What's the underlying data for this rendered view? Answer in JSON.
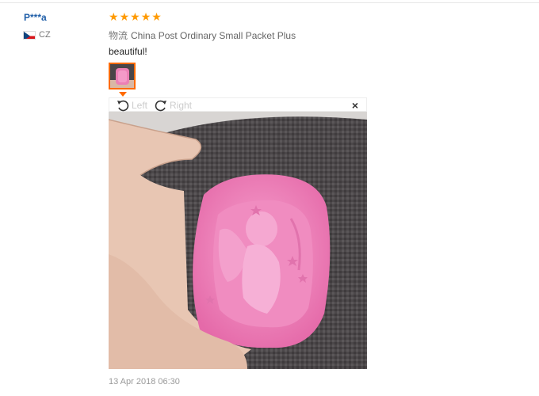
{
  "review": {
    "user_name": "P***a",
    "country_code": "CZ",
    "rating": 5,
    "shipping_label": "物流",
    "shipping_method": "China Post Ordinary Small Packet Plus",
    "feedback": "beautiful!",
    "date": "13 Apr 2018 06:30"
  },
  "viewer": {
    "rotate_left_label": "Left",
    "rotate_right_label": "Right",
    "close_symbol": "×"
  },
  "icons": {
    "star": "star-icon",
    "rotate_left": "rotate-left-icon",
    "rotate_right": "rotate-right-icon",
    "close": "close-icon",
    "flag": "czech-flag-icon"
  },
  "colors": {
    "star": "#ff9a00",
    "username": "#1f5ea8",
    "thumb_border": "#ff6a00",
    "mold_pink": "#ec7fb5"
  }
}
